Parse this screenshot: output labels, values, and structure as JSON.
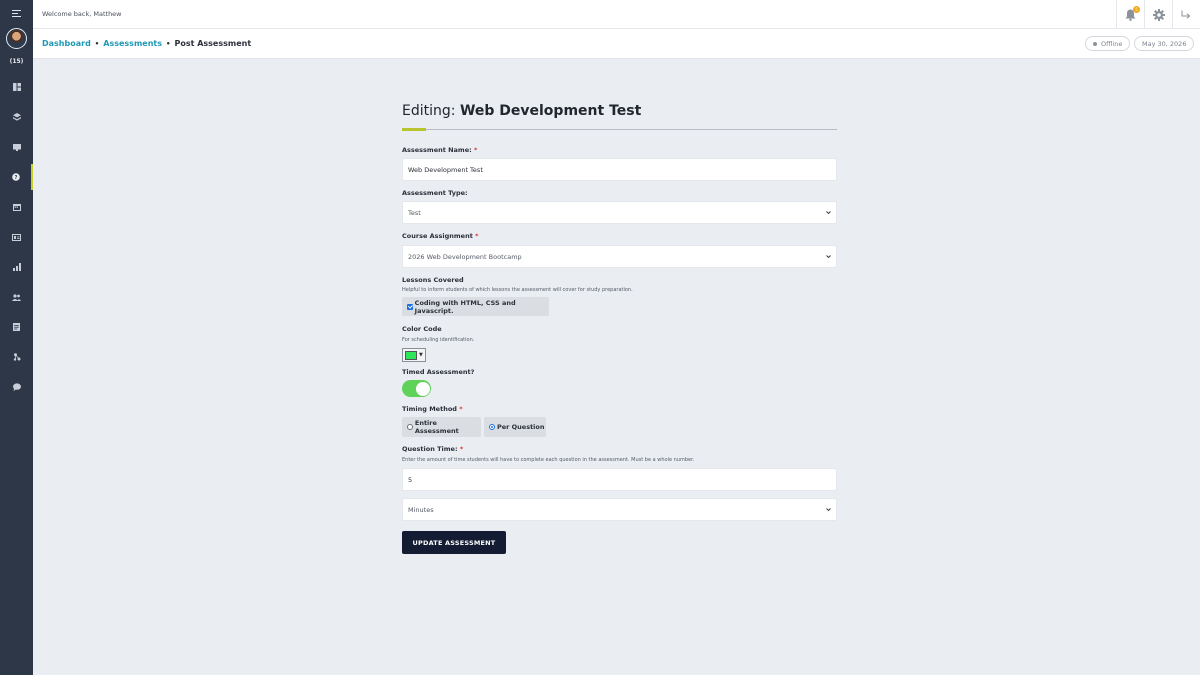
{
  "topbar": {
    "welcome": "Welcome back, Matthew",
    "notification_count": "5",
    "icons": [
      "bell-icon",
      "gear-icon",
      "logout-icon"
    ]
  },
  "sidebar": {
    "count_label": "(15)",
    "items": [
      {
        "icon": "dashboard-icon",
        "active": false
      },
      {
        "icon": "layers-icon",
        "active": false
      },
      {
        "icon": "book-icon",
        "active": false
      },
      {
        "icon": "assessment-icon",
        "active": true
      },
      {
        "icon": "calendar-icon",
        "active": false
      },
      {
        "icon": "id-card-icon",
        "active": false
      },
      {
        "icon": "chart-icon",
        "active": false
      },
      {
        "icon": "users-icon",
        "active": false
      },
      {
        "icon": "report-icon",
        "active": false
      },
      {
        "icon": "sitemap-icon",
        "active": false
      },
      {
        "icon": "chat-icon",
        "active": false
      }
    ]
  },
  "breadcrumb": {
    "items": [
      "Dashboard",
      "Assessments"
    ],
    "current": "Post Assessment",
    "separator": "•"
  },
  "status": {
    "label": "Offline",
    "date": "May 30, 2026"
  },
  "form": {
    "title_prefix": "Editing:",
    "title_name": "Web Development Test",
    "assessment_name": {
      "label": "Assessment Name:",
      "required": "*",
      "value": "Web Development Test"
    },
    "assessment_type": {
      "label": "Assessment Type:",
      "value": "Test"
    },
    "course_assignment": {
      "label": "Course Assignment",
      "required": "*",
      "value": "2026 Web Development Bootcamp"
    },
    "lessons": {
      "label": "Lessons Covered",
      "hint": "Helpful to inform students of which lessons the assessment will cover for study preparation.",
      "item": "Coding with HTML, CSS and Javascript.",
      "checked": true
    },
    "color_code": {
      "label": "Color Code",
      "hint": "For scheduling identification.",
      "value": "#2ee65a"
    },
    "timed": {
      "label": "Timed Assessment?",
      "on": true,
      "on_color": "#5fd25a"
    },
    "timing_method": {
      "label": "Timing Method",
      "required": "*",
      "options": [
        "Entire Assessment",
        "Per Question"
      ],
      "selected": "Per Question"
    },
    "question_time": {
      "label": "Question Time:",
      "required": "*",
      "hint": "Enter the amount of time students will have to complete each question in the assessment. Must be a whole number.",
      "value": "5",
      "unit": "Minutes"
    },
    "submit_label": "UPDATE ASSESSMENT"
  },
  "colors": {
    "accent_link": "#1f98b5",
    "sidebar_bg": "#2e3747",
    "button_bg": "#141c34",
    "active_bar": "#c4d22a",
    "required": "#d43a3a"
  }
}
